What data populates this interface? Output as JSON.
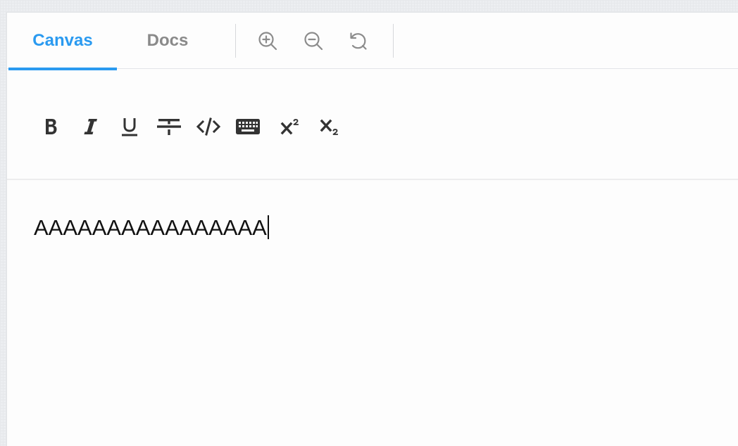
{
  "tabs": {
    "canvas_label": "Canvas",
    "docs_label": "Docs",
    "active": "Canvas"
  },
  "zoom_tools": {
    "zoom_in_icon": "zoom-in-icon",
    "zoom_out_icon": "zoom-out-icon",
    "reset_icon": "reset-rotate-icon"
  },
  "format_tools": [
    {
      "name": "bold",
      "icon": "bold-icon"
    },
    {
      "name": "italic",
      "icon": "italic-icon"
    },
    {
      "name": "underline",
      "icon": "underline-icon"
    },
    {
      "name": "strikethrough",
      "icon": "strikethrough-icon"
    },
    {
      "name": "code",
      "icon": "code-icon"
    },
    {
      "name": "keyboard",
      "icon": "keyboard-icon"
    },
    {
      "name": "superscript",
      "icon": "superscript-icon"
    },
    {
      "name": "subscript",
      "icon": "subscript-icon"
    }
  ],
  "editor": {
    "content": "AAAAAAAAAAAAAAAA"
  },
  "colors": {
    "accent": "#2a9af0",
    "inactive_tab": "#8a8a8a",
    "icon": "#333333",
    "zoom_icon": "#8c8c8c"
  }
}
